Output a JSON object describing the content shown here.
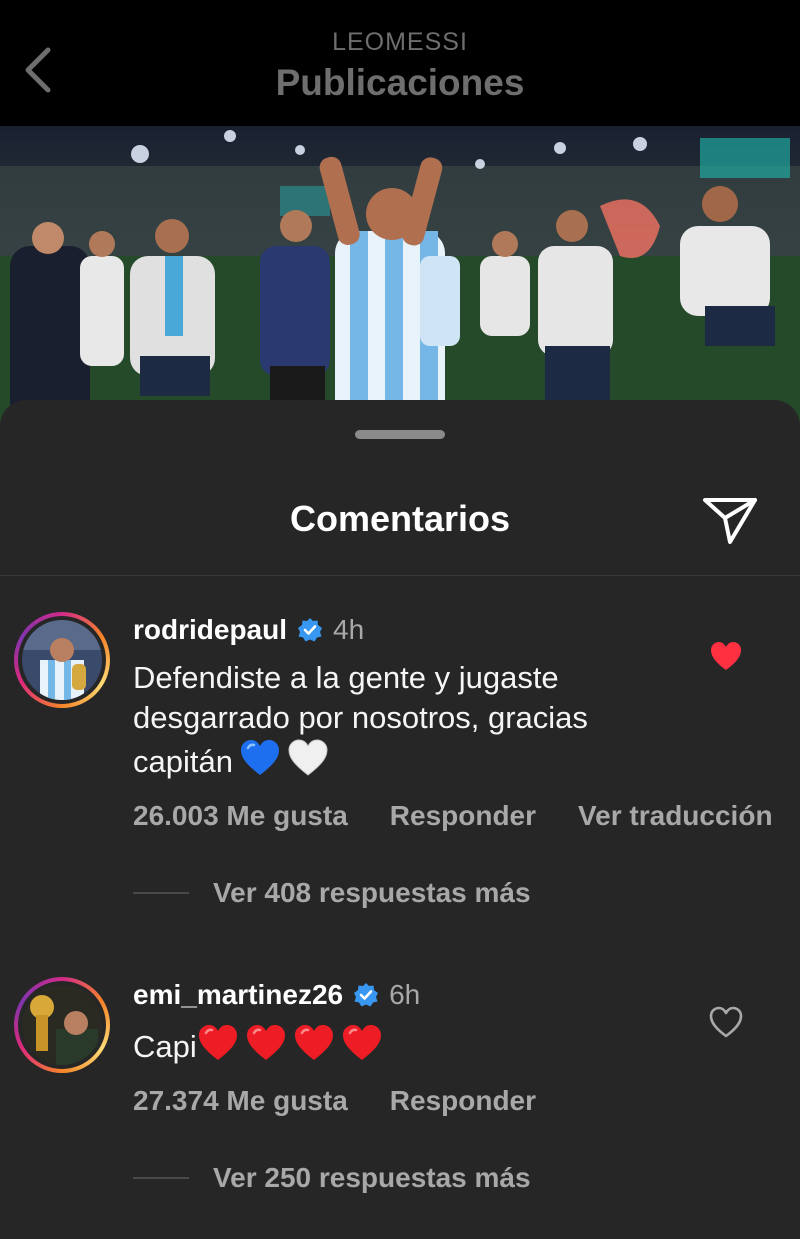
{
  "header": {
    "account": "LEOMESSI",
    "title": "Publicaciones"
  },
  "sheet": {
    "title": "Comentarios"
  },
  "comments": [
    {
      "username": "rodridepaul",
      "time": "4h",
      "text": "Defendiste a la gente y jugaste desgarrado por nosotros, gracias capitán",
      "emojis": [
        "blue-heart",
        "white-heart"
      ],
      "likes": "26.003 Me gusta",
      "reply": "Responder",
      "translate": "Ver traducción",
      "liked": true,
      "replies": "Ver 408 respuestas más"
    },
    {
      "username": "emi_martinez26",
      "time": "6h",
      "text": "Capi",
      "emojis": [
        "red-heart",
        "red-heart",
        "red-heart",
        "red-heart"
      ],
      "likes": "27.374 Me gusta",
      "reply": "Responder",
      "liked": false,
      "replies": "Ver 250 respuestas más"
    }
  ],
  "colors": {
    "background": "#262626",
    "like_active": "#ff3040",
    "verified": "#3897f0",
    "secondary_text": "#a8a8a8"
  }
}
